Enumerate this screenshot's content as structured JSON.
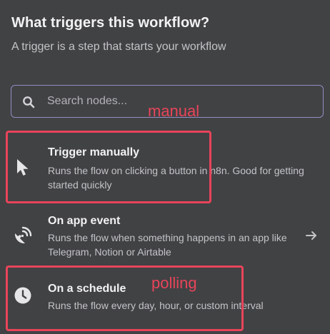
{
  "header": {
    "title": "What triggers this workflow?",
    "subtitle": "A trigger is a step that starts your workflow"
  },
  "search": {
    "placeholder": "Search nodes...",
    "value": "",
    "icon": "search-icon"
  },
  "triggers": [
    {
      "name": "Trigger manually",
      "description": "Runs the flow on clicking a button in n8n. Good for getting started quickly",
      "icon": "cursor-pointer-icon"
    },
    {
      "name": "On app event",
      "description": "Runs the flow when something happens in an app like Telegram, Notion or Airtable",
      "icon": "satellite-dish-icon",
      "has_arrow": true
    },
    {
      "name": "On a schedule",
      "description": "Runs the flow every day, hour, or custom interval",
      "icon": "clock-icon"
    }
  ],
  "annotations": [
    {
      "label": "manual",
      "color": "#e8445a"
    },
    {
      "label": "polling",
      "color": "#e8445a"
    }
  ],
  "colors": {
    "background": "#414244",
    "search_border": "#8f8ec4",
    "annotation": "#e8445a",
    "primary_text": "#f2f2f3",
    "secondary_text": "#c4c4c8"
  }
}
